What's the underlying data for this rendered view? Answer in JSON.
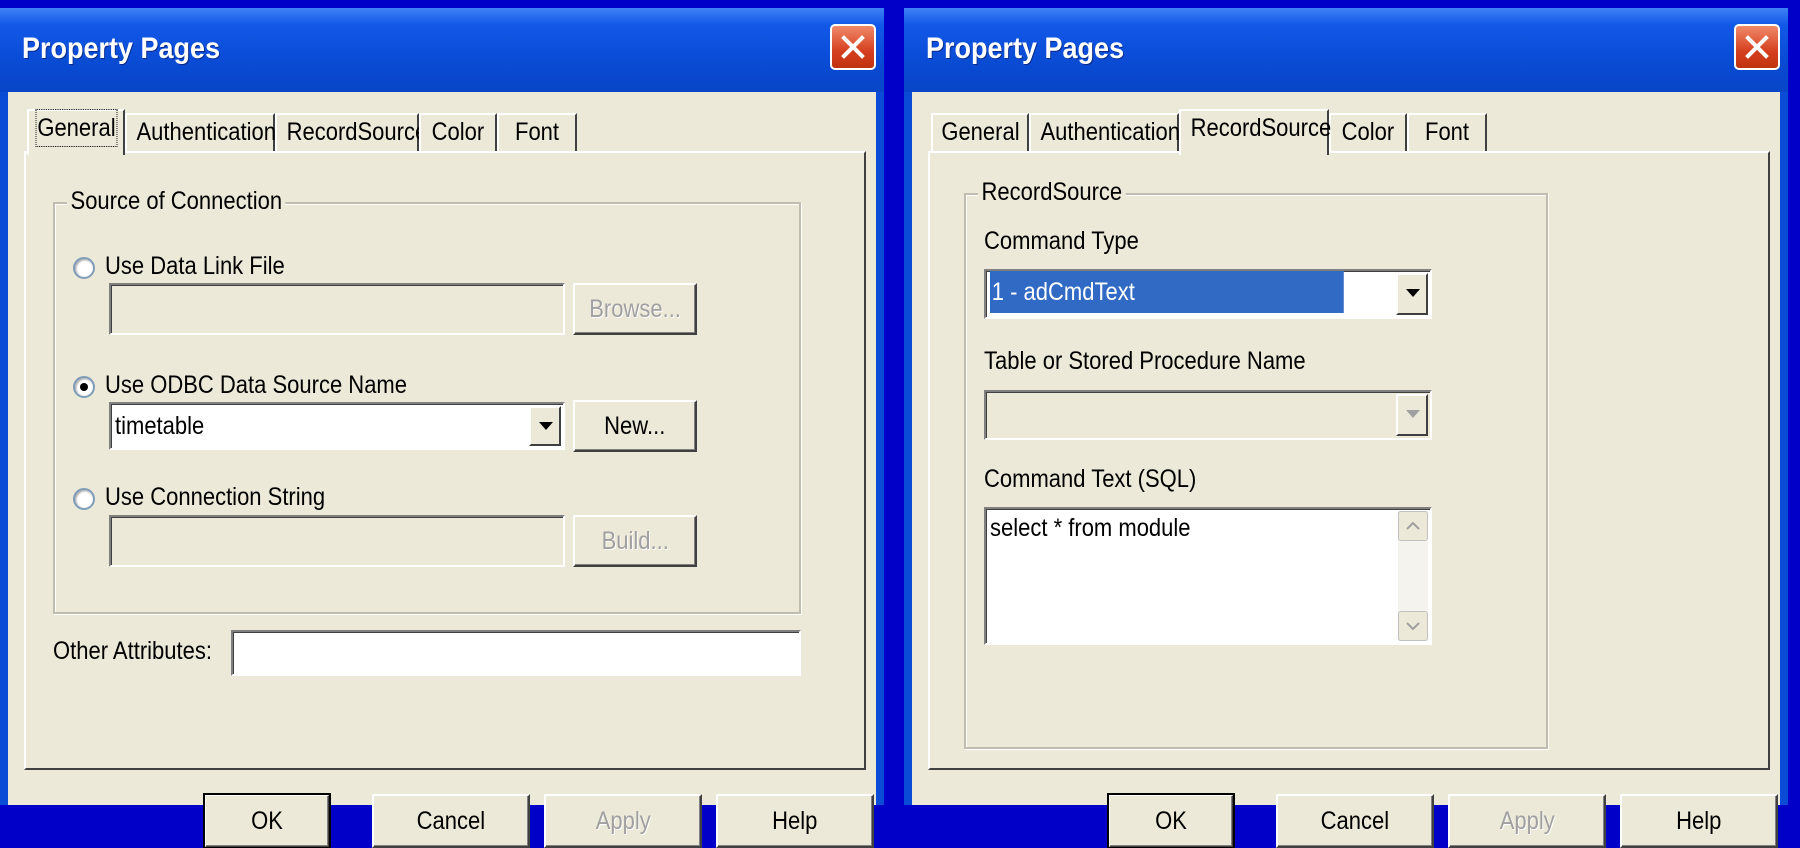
{
  "dialogs": [
    {
      "title": "Property Pages",
      "tabs": [
        "General",
        "Authentication",
        "RecordSource",
        "Color",
        "Font"
      ],
      "active_tab": "General",
      "source_group_label": "Source of Connection",
      "data_link_label": "Use Data Link File",
      "data_link_value": "",
      "browse_label": "Browse...",
      "odbc_label": "Use ODBC Data Source Name",
      "odbc_value": "timetable",
      "new_label": "New...",
      "conn_string_label": "Use Connection String",
      "conn_string_value": "",
      "build_label": "Build...",
      "other_attributes_label": "Other Attributes:",
      "other_attributes_value": "",
      "selected_source": "odbc"
    },
    {
      "title": "Property Pages",
      "tabs": [
        "General",
        "Authentication",
        "RecordSource",
        "Color",
        "Font"
      ],
      "active_tab": "RecordSource",
      "record_group_label": "RecordSource",
      "command_type_label": "Command Type",
      "command_type_value": "1 - adCmdText",
      "table_name_label": "Table or Stored Procedure Name",
      "table_name_value": "",
      "command_text_label": "Command Text (SQL)",
      "command_text_value": "select * from module"
    }
  ],
  "buttons": {
    "ok": "OK",
    "cancel": "Cancel",
    "apply": "Apply",
    "help": "Help"
  },
  "colors": {
    "desktop": "#0000c8",
    "titlebar": "#0a4cd6",
    "dialog_face": "#ece9d8",
    "close_button": "#d5401f",
    "selection": "#316ac5"
  }
}
